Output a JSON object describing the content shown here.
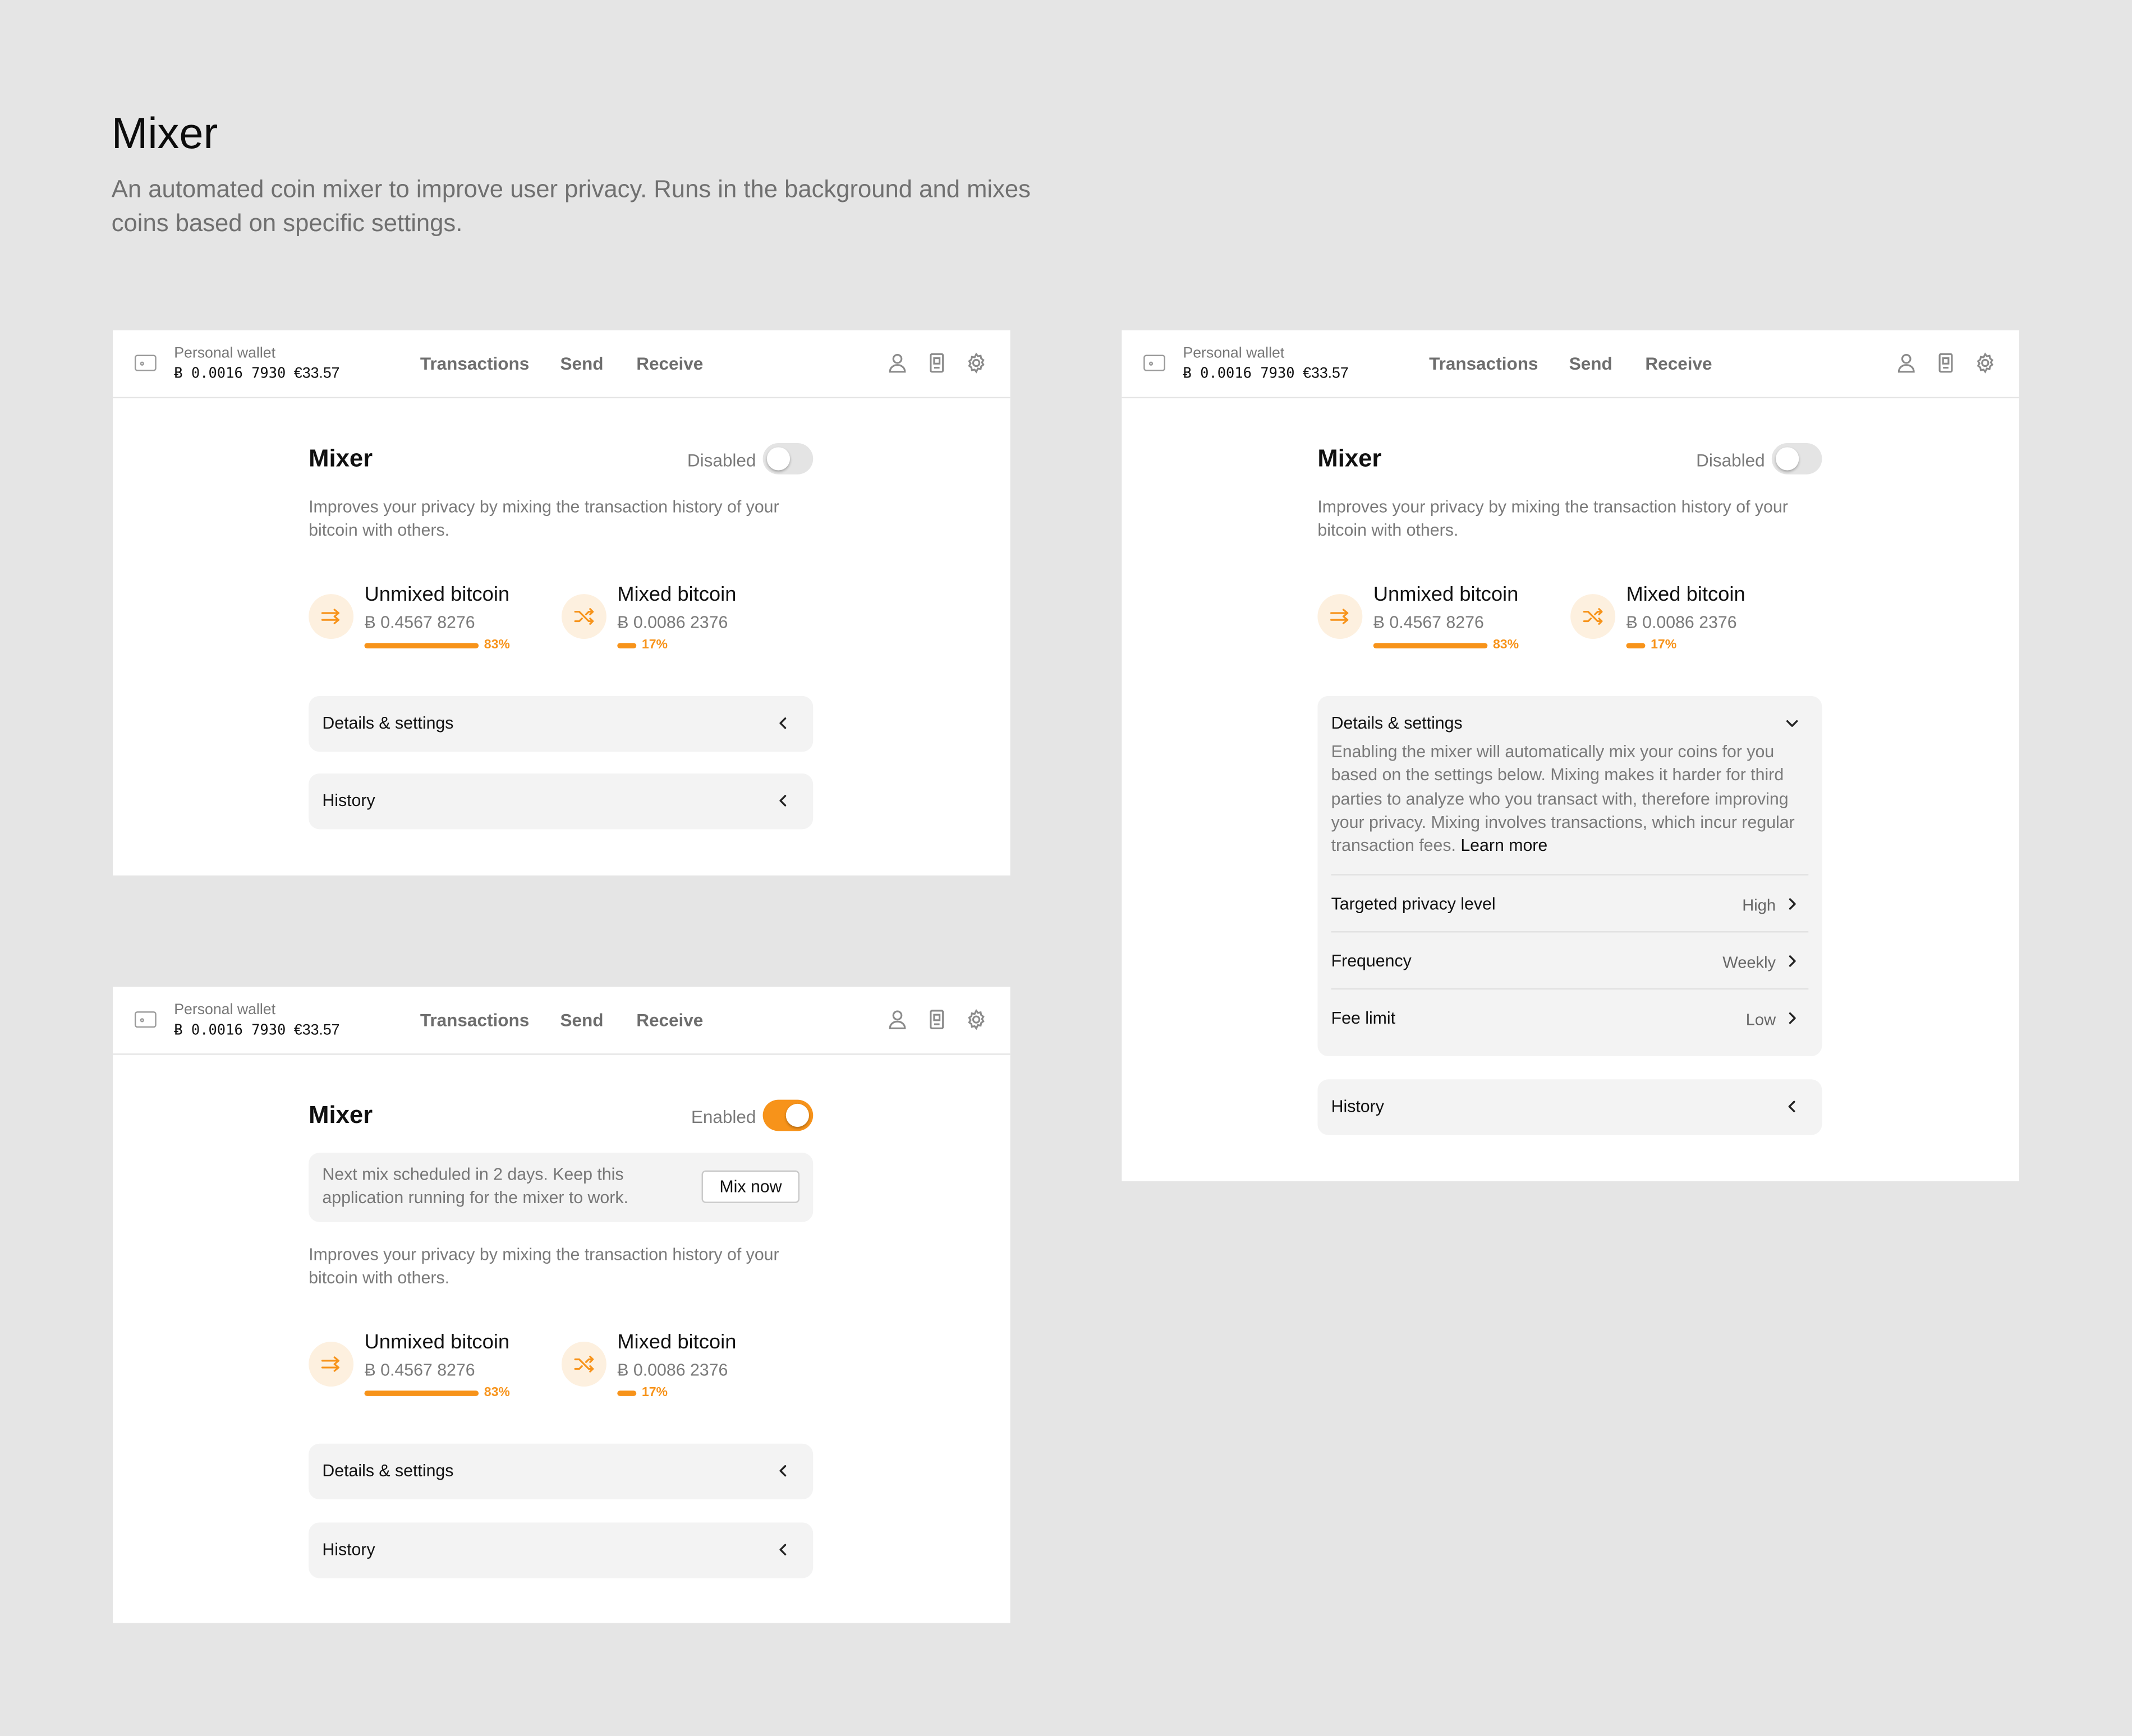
{
  "page": {
    "title": "Mixer",
    "subtitle": "An automated coin mixer to improve user privacy. Runs in the background and mixes coins based on specific settings."
  },
  "colors": {
    "accent": "#f7931a",
    "accent_soft": "#fdf0df",
    "panel": "#f3f3f3",
    "background": "#e5e5e5"
  },
  "topbar": {
    "wallet_icon": "wallet-icon",
    "wallet_name": "Personal wallet",
    "balance_btc": "Ƀ 0.0016 7930",
    "balance_eur": "€33.57",
    "nav": [
      "Transactions",
      "Send",
      "Receive"
    ],
    "icons": [
      "user-icon",
      "device-icon",
      "gear-icon"
    ]
  },
  "mixer": {
    "title": "Mixer",
    "description": "Improves your privacy by mixing the transaction history of your bitcoin with others.",
    "unmixed": {
      "title": "Unmixed bitcoin",
      "amount": "Ƀ 0.4567 8276",
      "percent_label": "83%",
      "percent": 83,
      "icon": "arrows-right-icon"
    },
    "mixed": {
      "title": "Mixed bitcoin",
      "amount": "Ƀ 0.0086 2376",
      "percent_label": "17%",
      "percent": 17,
      "icon": "shuffle-icon"
    },
    "details_label": "Details & settings",
    "history_label": "History"
  },
  "screens": {
    "disabled": {
      "toggle_label": "Disabled",
      "enabled": false
    },
    "enabled": {
      "toggle_label": "Enabled",
      "enabled": true,
      "notice": "Next mix scheduled in 2 days. Keep this application running for the mixer to work.",
      "mix_now": "Mix now"
    },
    "expanded": {
      "toggle_label": "Disabled",
      "enabled": false,
      "details_text": "Enabling the mixer will automatically mix your coins for you based on the settings below. Mixing makes it harder for third parties to analyze who you transact with, therefore improving your privacy. Mixing involves transactions, which incur regular transaction fees.",
      "learn_more": "Learn more",
      "settings": [
        {
          "label": "Targeted privacy level",
          "value": "High"
        },
        {
          "label": "Frequency",
          "value": "Weekly"
        },
        {
          "label": "Fee limit",
          "value": "Low"
        }
      ]
    }
  }
}
